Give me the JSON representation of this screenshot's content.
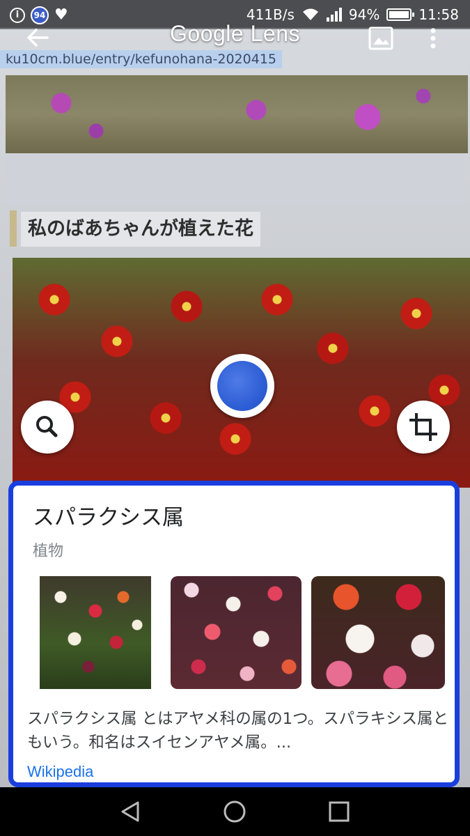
{
  "status_bar": {
    "info_icon": "i",
    "badge": "94",
    "heart_icon": "♥",
    "network_speed": "411B/s",
    "battery_percent": "94%",
    "time": "11:58"
  },
  "lens_bar": {
    "title": "Google Lens"
  },
  "viewfinder": {
    "url_text": "ku10cm.blue/entry/kefunohana-2020415",
    "heading_text": "私のばあちゃんが植えた花"
  },
  "result": {
    "title": "スパラクシス属",
    "subtitle": "植物",
    "description": "スパラクシス属 とはアヤメ科の属の1つ。スパラキシス属ともいう。和名はスイセンアヤメ属。...",
    "source": "Wikipedia",
    "highlight_color": "#1a3ede"
  },
  "colors": {
    "link": "#1a73e8",
    "shutter": "#2f5fd6"
  }
}
